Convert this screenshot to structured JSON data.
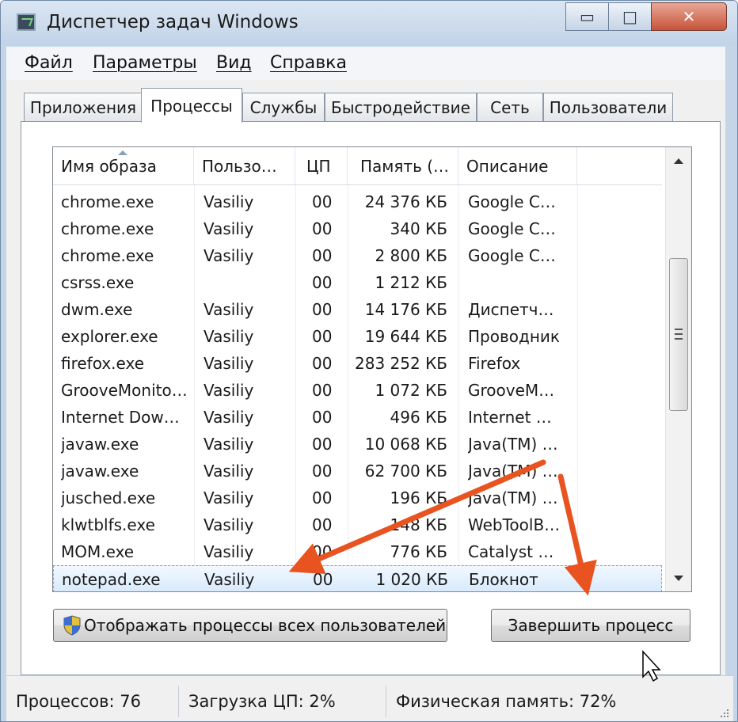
{
  "window": {
    "title": "Диспетчер задач Windows",
    "min": "▭",
    "max": "□",
    "close": "✕"
  },
  "menu": [
    "Файл",
    "Параметры",
    "Вид",
    "Справка"
  ],
  "tabs": [
    "Приложения",
    "Процессы",
    "Службы",
    "Быстродействие",
    "Сеть",
    "Пользователи"
  ],
  "active_tab": "Процессы",
  "columns": [
    "Имя образа",
    "Пользо…",
    "ЦП",
    "Память (…",
    "Описание"
  ],
  "rows": [
    [
      "chrome.exe",
      "Vasiliy",
      "00",
      "24 376 КБ",
      "Google C…"
    ],
    [
      "chrome.exe",
      "Vasiliy",
      "00",
      "340 КБ",
      "Google C…"
    ],
    [
      "chrome.exe",
      "Vasiliy",
      "00",
      "2 800 КБ",
      "Google C…"
    ],
    [
      "csrss.exe",
      "",
      "00",
      "1 212 КБ",
      ""
    ],
    [
      "dwm.exe",
      "Vasiliy",
      "00",
      "14 176 КБ",
      "Диспетч…"
    ],
    [
      "explorer.exe",
      "Vasiliy",
      "00",
      "19 644 КБ",
      "Проводник"
    ],
    [
      "firefox.exe",
      "Vasiliy",
      "00",
      "283 252 КБ",
      "Firefox"
    ],
    [
      "GrooveMonito…",
      "Vasiliy",
      "00",
      "1 072 КБ",
      "GrooveM…"
    ],
    [
      "Internet Dow…",
      "Vasiliy",
      "00",
      "496 КБ",
      "Internet …"
    ],
    [
      "javaw.exe",
      "Vasiliy",
      "00",
      "10 068 КБ",
      "Java(TM) …"
    ],
    [
      "javaw.exe",
      "Vasiliy",
      "00",
      "62 700 КБ",
      "Java(TM) …"
    ],
    [
      "jusched.exe",
      "Vasiliy",
      "00",
      "196 КБ",
      "Java(TM) …"
    ],
    [
      "klwtblfs.exe",
      "Vasiliy",
      "00",
      "148 КБ",
      "WebToolB…"
    ],
    [
      "MOM.exe",
      "Vasiliy",
      "00",
      "776 КБ",
      "Catalyst …"
    ],
    [
      "notepad.exe",
      "Vasiliy",
      "00",
      "1 020 КБ",
      "Блокнот"
    ]
  ],
  "selected_row": 14,
  "buttons": {
    "show_all": "Отображать процессы всех пользователей",
    "end_process": "Завершить процесс"
  },
  "status": {
    "processes": "Процессов: 76",
    "cpu": "Загрузка ЦП: 2%",
    "memory": "Физическая память: 72%"
  },
  "colors": {
    "annotation_arrow": "#e8531f",
    "selection": "#d8eafc"
  }
}
